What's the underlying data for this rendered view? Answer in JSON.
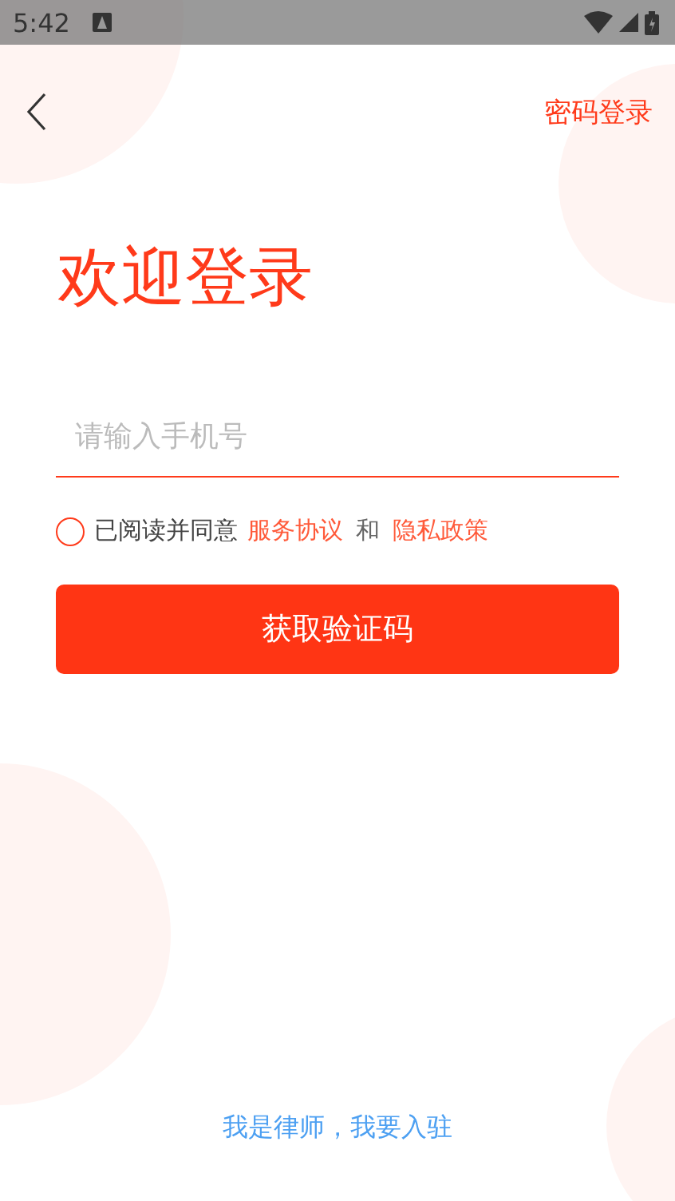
{
  "status_bar": {
    "time": "5:42"
  },
  "header": {
    "right_link": "密码登录"
  },
  "title": "欢迎登录",
  "phone_field": {
    "placeholder": "请输入手机号"
  },
  "agreement": {
    "checked": false,
    "prefix": "已阅读并同意",
    "link_1": "服务协议",
    "joiner": "和",
    "link_2": "隐私政策"
  },
  "submit_button": "获取验证码",
  "footer_link": "我是律师，我要入驻"
}
